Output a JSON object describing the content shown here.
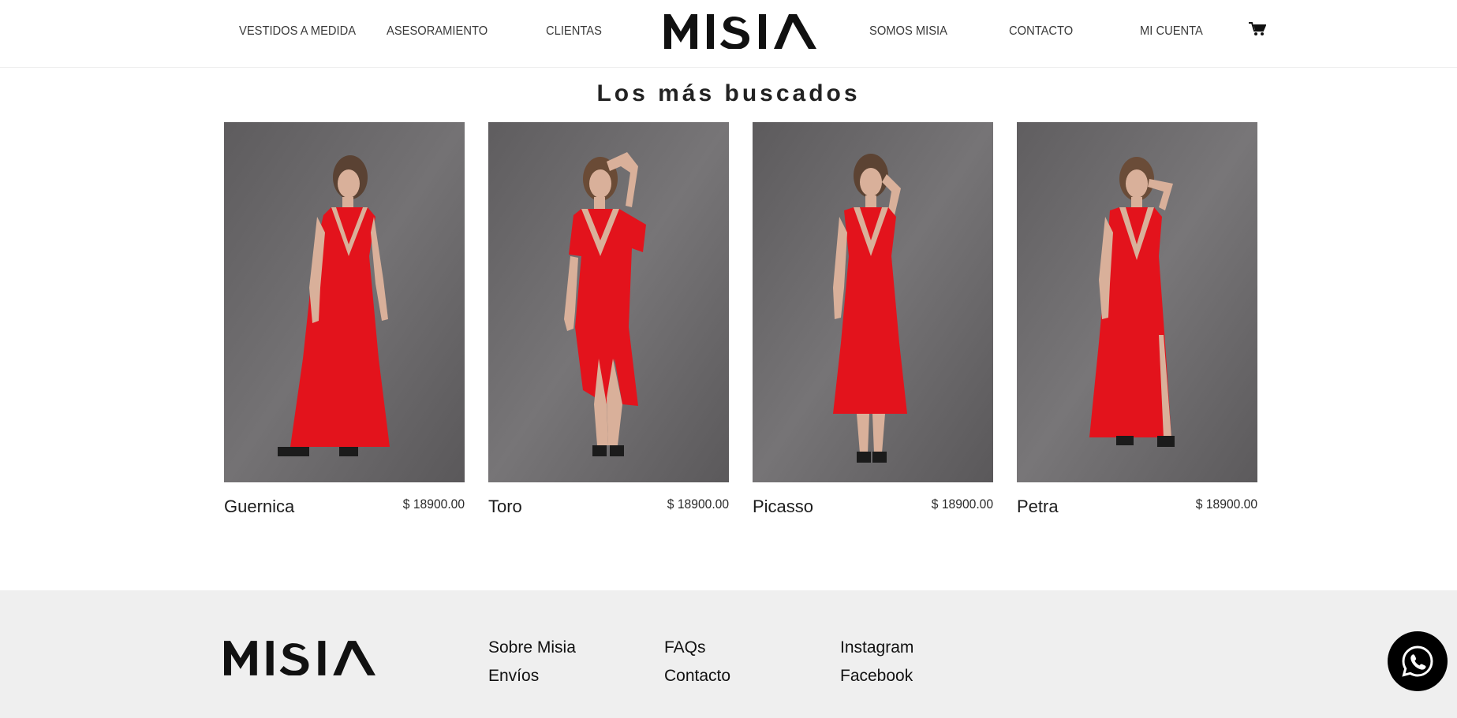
{
  "nav": {
    "left": [
      "VESTIDOS A MEDIDA",
      "ASESORAMIENTO",
      "CLIENTAS"
    ],
    "right": [
      "SOMOS MISIA",
      "CONTACTO",
      "MI CUENTA"
    ],
    "logo": "MISIA",
    "cart_icon": "cart-icon"
  },
  "section": {
    "title": "Los más buscados"
  },
  "products": [
    {
      "name": "Guernica",
      "price": "$ 18900.00"
    },
    {
      "name": "Toro",
      "price": "$ 18900.00"
    },
    {
      "name": "Picasso",
      "price": "$ 18900.00"
    },
    {
      "name": "Petra",
      "price": "$ 18900.00"
    }
  ],
  "footer": {
    "logo": "MISIA",
    "col1": [
      "Sobre Misia",
      "Envíos"
    ],
    "col2": [
      "FAQs",
      "Contacto"
    ],
    "col3": [
      "Instagram",
      "Facebook"
    ]
  },
  "colors": {
    "dress": "#e3131c",
    "backdrop": "#6f6d6f",
    "footer_bg": "#efefef",
    "whatsapp_bg": "#000000"
  },
  "whatsapp_icon": "whatsapp-icon"
}
